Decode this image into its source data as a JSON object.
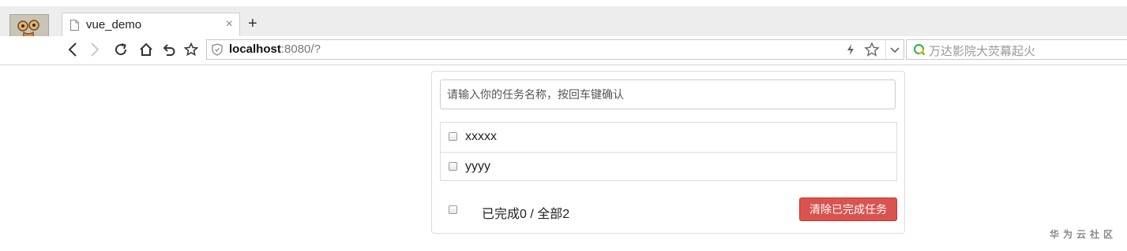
{
  "browser": {
    "tab": {
      "title": "vue_demo",
      "close_glyph": "×"
    },
    "new_tab_glyph": "+",
    "address": {
      "host": "localhost",
      "rest": ":8080/?"
    },
    "search": {
      "placeholder": "万达影院大荧幕起火"
    }
  },
  "app": {
    "input": {
      "placeholder": "请输入你的任务名称，按回车键确认",
      "value": ""
    },
    "tasks": [
      {
        "text": "xxxxx",
        "done": false
      },
      {
        "text": "yyyy",
        "done": false
      }
    ],
    "footer": {
      "summary": "已完成0 / 全部2",
      "clear_label": "清除已完成任务"
    }
  },
  "watermark": "华为云社区",
  "colors": {
    "danger": "#d9534f",
    "border": "#dddddd",
    "tabbar": "#ededed"
  }
}
